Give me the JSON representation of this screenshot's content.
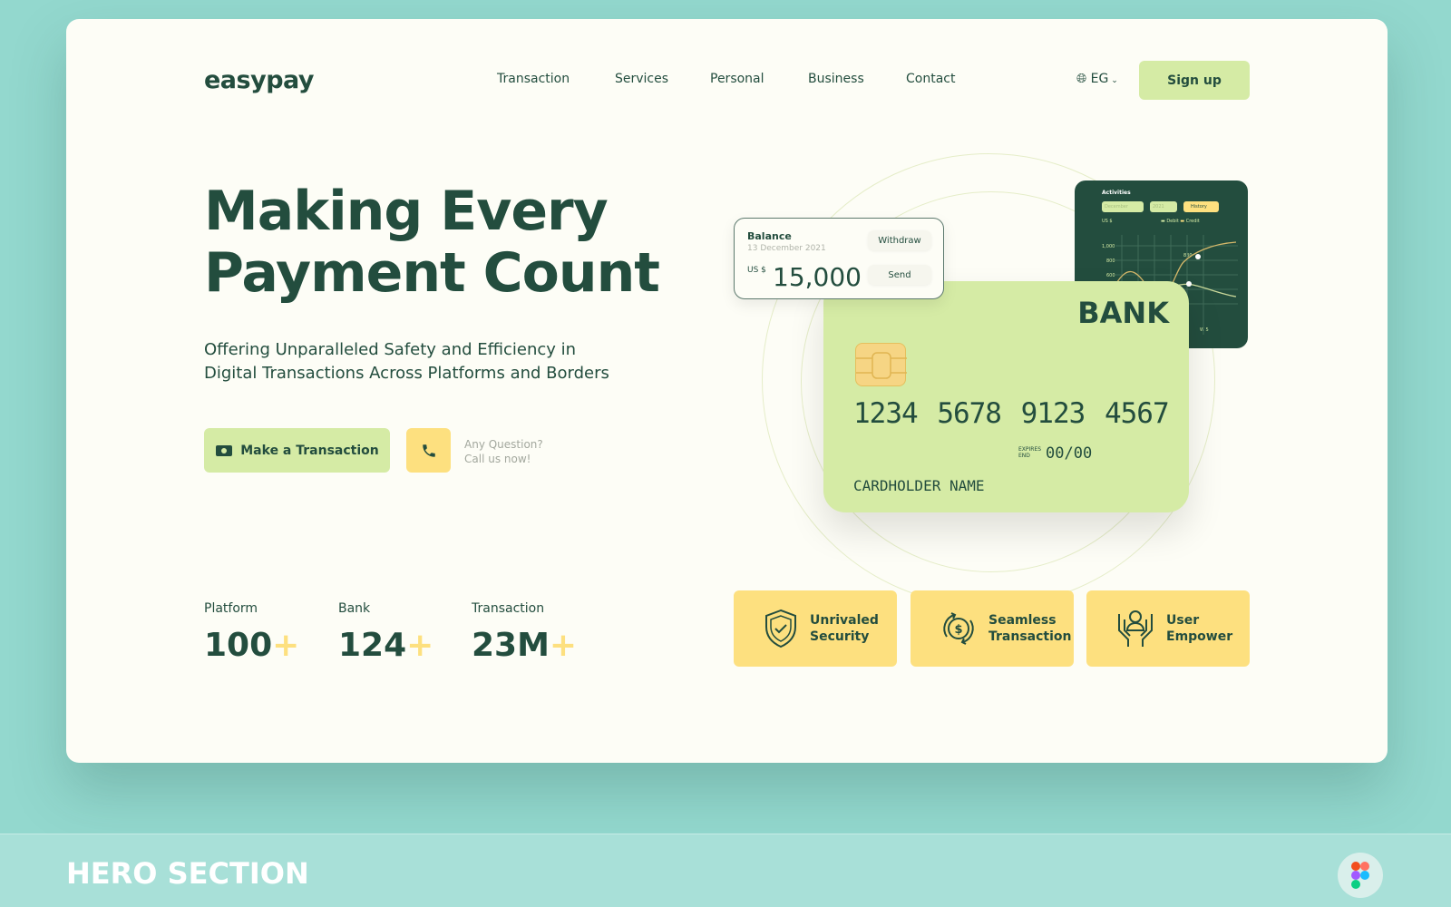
{
  "brand": {
    "name": "easypay"
  },
  "nav": [
    "Transaction",
    "Services",
    "Personal",
    "Business",
    "Contact"
  ],
  "language": "EG",
  "signup_label": "Sign up",
  "hero": {
    "title_line1": "Making Every",
    "title_line2": "Payment Count",
    "subtitle_line1": "Offering Unparalleled Safety and Efficiency in",
    "subtitle_line2": "Digital Transactions Across Platforms and Borders",
    "cta": "Make a Transaction",
    "question": "Any Question?",
    "call": "Call us now!"
  },
  "stats": [
    {
      "label": "Platform",
      "value": "100",
      "suffix": "+"
    },
    {
      "label": "Bank",
      "value": "124",
      "suffix": "+"
    },
    {
      "label": "Transaction",
      "value": "23M",
      "suffix": "+"
    }
  ],
  "features": [
    {
      "label1": "Unrivaled",
      "label2": "Security",
      "icon": "shield-check-icon"
    },
    {
      "label1": "Seamless",
      "label2": "Transaction",
      "icon": "dollar-cycle-icon"
    },
    {
      "label1": "User",
      "label2": "Empower",
      "icon": "hands-user-icon"
    }
  ],
  "card": {
    "bank": "BANK",
    "number": "1234 5678 9123 4567",
    "expires_label1": "EXPIRES",
    "expires_label2": "END",
    "expires": "00/00",
    "holder": "CARDHOLDER NAME"
  },
  "balance": {
    "title": "Balance",
    "date": "13 December 2021",
    "currency": "US $",
    "amount": "15,000",
    "withdraw": "Withdraw",
    "send": "Send"
  },
  "activities": {
    "title": "Activities",
    "month": "December",
    "year": "2021",
    "history": "History",
    "unit": "US $",
    "legend_debit": "Debit",
    "legend_credit": "Credit",
    "y_ticks": [
      "1,000",
      "800",
      "600"
    ],
    "point_label": "830",
    "x_label": "W 5"
  },
  "footer": {
    "section_title": "HERO SECTION"
  },
  "colors": {
    "dark_green": "#234d3e",
    "light_green": "#d5eba5",
    "yellow": "#fde07f",
    "background": "#93d8ce"
  }
}
